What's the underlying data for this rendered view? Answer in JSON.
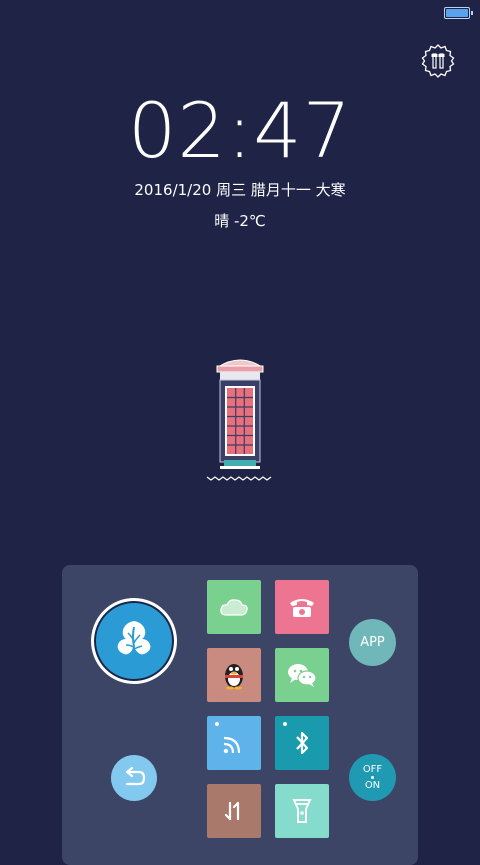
{
  "status_bar": {
    "battery_level": 1.0
  },
  "lockscreen": {
    "time": "02:47",
    "date": "2016/1/20  周三  腊月十一 大寒",
    "weather": "晴  -2℃"
  },
  "shortcut_panel": {
    "app_label": "APP",
    "toggle_off_label": "OFF",
    "toggle_on_label": "ON",
    "tiles": [
      {
        "name": "weather-tile",
        "icon": "cloud-icon",
        "color": "#7ad08e"
      },
      {
        "name": "phone-tile",
        "icon": "telephone-icon",
        "color": "#ee7591"
      },
      {
        "name": "qq-tile",
        "icon": "penguin-icon",
        "color": "#c98a80"
      },
      {
        "name": "wechat-tile",
        "icon": "chat-bubbles-icon",
        "color": "#7ad08e"
      },
      {
        "name": "wifi-tile",
        "icon": "wifi-icon",
        "color": "#5eb3ea"
      },
      {
        "name": "bluetooth-tile",
        "icon": "bluetooth-icon",
        "color": "#1a9aad"
      },
      {
        "name": "data-tile",
        "icon": "data-transfer-icon",
        "color": "#a97a6c"
      },
      {
        "name": "flashlight-tile",
        "icon": "flashlight-icon",
        "color": "#86dccc"
      }
    ]
  },
  "colors": {
    "background": "#1f2346",
    "panel": "#3d4566",
    "accent_blue": "#2a9bd5"
  }
}
